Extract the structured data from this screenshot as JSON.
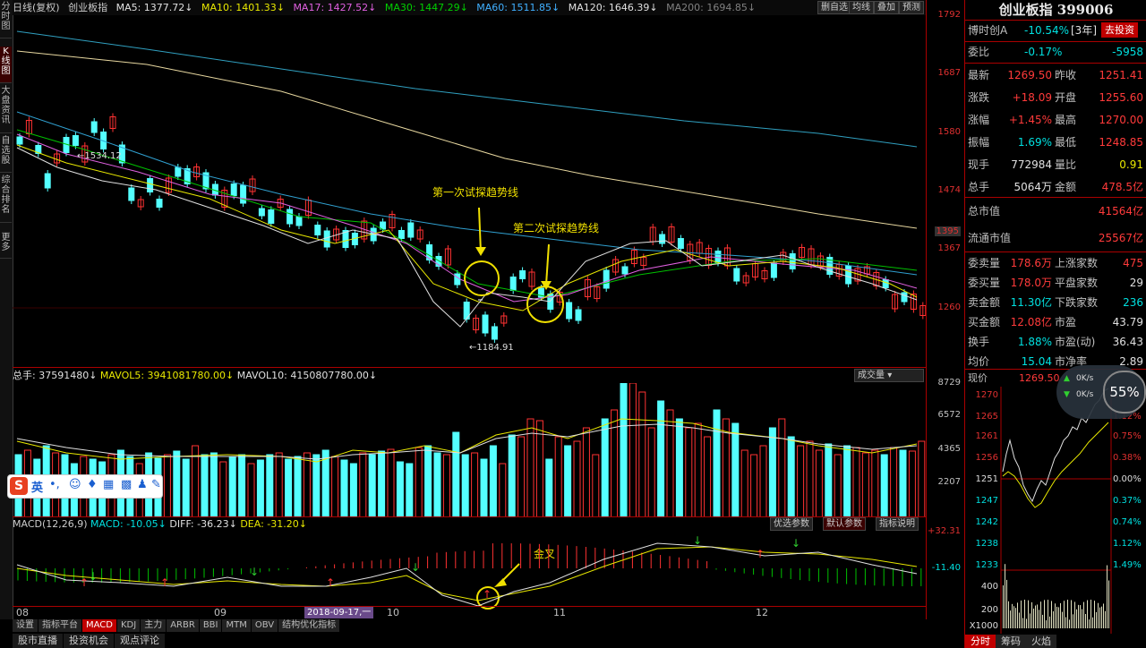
{
  "left_tabs": [
    "分时图",
    "K线图",
    "大盘资讯",
    "自选股",
    "综合排名",
    "更多"
  ],
  "top_bar": {
    "period": "日线(复权)",
    "name": "创业板指",
    "ma5": "MA5: 1377.72↓",
    "ma10": "MA10: 1401.33↓",
    "ma17": "MA17: 1427.52↓",
    "ma30": "MA30: 1447.29↓",
    "ma60": "MA60: 1511.85↓",
    "ma120": "MA120: 1646.39↓",
    "ma200": "MA200: 1694.85↓",
    "buttons": [
      "删自选",
      "均线",
      "叠加",
      "预测"
    ]
  },
  "price_axis": [
    "1792",
    "1687",
    "1580",
    "1474",
    "1395",
    "1367",
    "1260"
  ],
  "vol_axis": [
    "8729",
    "6572",
    "4365",
    "2207"
  ],
  "macd_axis": [
    "+32.31",
    "-11.40"
  ],
  "price_labels": {
    "high": "1534.12",
    "low": "1184.91"
  },
  "annotations": {
    "first": "第一次试探趋势线",
    "second": "第二次试探趋势线",
    "golden": "金叉"
  },
  "volume_header": {
    "total": "总手: 37591480↓",
    "mavol5": "MAVOL5: 3941081780.00↓",
    "mavol10": "MAVOL10: 4150807780.00↓",
    "select": "成交量"
  },
  "macd_header": {
    "name": "MACD(12,26,9)",
    "macd": "MACD: -10.05↓",
    "diff": "DIFF: -36.23↓",
    "dea": "DEA: -31.20↓",
    "btn1": "优选参数",
    "btn2": "默认参数",
    "btn3": "指标说明"
  },
  "x_axis": [
    "08",
    "09",
    "10",
    "11",
    "12"
  ],
  "bottom_tabs": [
    "设置",
    "指标平台",
    "MACD",
    "KDJ",
    "主力",
    "ARBR",
    "BBI",
    "MTM",
    "OBV",
    "结构优化指标"
  ],
  "bottom_date": "2018-09-17,一",
  "bottom_tabs2": [
    "股市直播",
    "投资机会",
    "观点评论"
  ],
  "ime": {
    "label": "英"
  },
  "right": {
    "title": "创业板指 399006",
    "bst": {
      "name": "博时创A",
      "change": "-10.54%",
      "years": "[3年]",
      "btn": "去投资"
    },
    "weibi": {
      "k": "委比",
      "v": "-0.17%",
      "v2": "-5958"
    },
    "quote": [
      {
        "k1": "最新",
        "v1": "1269.50",
        "k2": "昨收",
        "v2": "1251.41"
      },
      {
        "k1": "涨跌",
        "v1": "+18.09",
        "k2": "开盘",
        "v2": "1255.60"
      },
      {
        "k1": "涨幅",
        "v1": "+1.45%",
        "k2": "最高",
        "v2": "1270.00"
      },
      {
        "k1": "振幅",
        "v1": "1.69%",
        "k2": "最低",
        "v2": "1248.85"
      },
      {
        "k1": "现手",
        "v1": "772984",
        "k2": "量比",
        "v2": "0.91"
      },
      {
        "k1": "总手",
        "v1": "5064万",
        "k2": "金额",
        "v2": "478.5亿"
      }
    ],
    "mkt": [
      {
        "k": "总市值",
        "v": "41564亿"
      },
      {
        "k": "流通市值",
        "v": "25567亿"
      }
    ],
    "stats": [
      {
        "k1": "委卖量",
        "v1": "178.6万",
        "k2": "上涨家数",
        "v2": "475"
      },
      {
        "k1": "委买量",
        "v1": "178.0万",
        "k2": "平盘家数",
        "v2": "29"
      },
      {
        "k1": "卖金额",
        "v1": "11.30亿",
        "k2": "下跌家数",
        "v2": "236"
      },
      {
        "k1": "买金额",
        "v1": "12.08亿",
        "k2": "市盈",
        "v2": "43.79"
      },
      {
        "k1": "换手",
        "v1": "1.88%",
        "k2": "市盈(动)",
        "v2": "36.43"
      },
      {
        "k1": "均价",
        "v1": "15.04",
        "k2": "市净率",
        "v2": "2.89"
      }
    ],
    "mini": {
      "label": "现价",
      "price": "1269.50",
      "left_ticks": [
        "1270",
        "1265",
        "1261",
        "1256",
        "1251",
        "1247",
        "1242",
        "1238",
        "1233",
        "400",
        "200",
        "X1000"
      ],
      "right_ticks": [
        "1.49%",
        "1.12%",
        "0.75%",
        "0.38%",
        "0.00%",
        "0.37%",
        "0.74%",
        "1.12%",
        "1.49%"
      ]
    },
    "bottom_tabs": [
      "分时",
      "筹码",
      "火焰"
    ]
  },
  "speed": {
    "up": "0K/s",
    "down": "0K/s",
    "pct": "55%"
  }
}
